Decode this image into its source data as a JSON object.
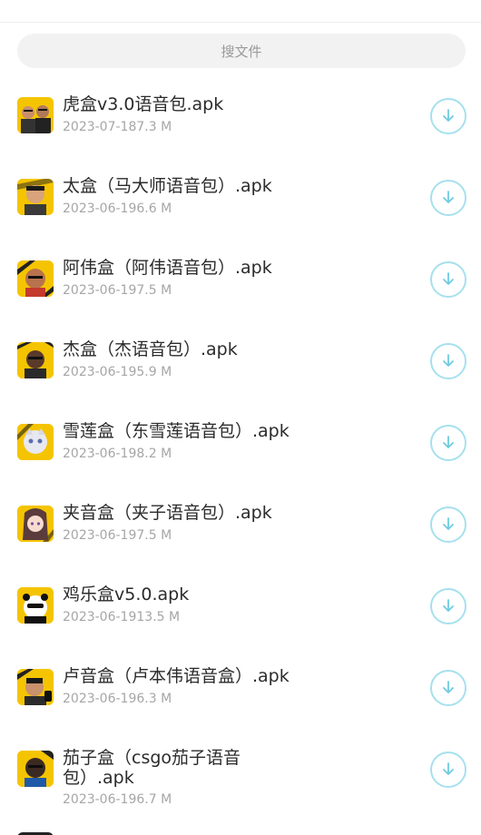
{
  "search": {
    "placeholder": "搜文件"
  },
  "files": [
    {
      "name": "虎盒v3.0语音包.apk",
      "date": "2023-07-18",
      "size": "7.3 M",
      "icon": "avatar-duo-icon"
    },
    {
      "name": "太盒（马大师语音包）.apk",
      "date": "2023-06-19",
      "size": "6.6 M",
      "icon": "avatar-portrait-icon"
    },
    {
      "name": "阿伟盒（阿伟语音包）.apk",
      "date": "2023-06-19",
      "size": "7.5 M",
      "icon": "avatar-portrait-icon"
    },
    {
      "name": "杰盒（杰语音包）.apk",
      "date": "2023-06-19",
      "size": "5.9 M",
      "icon": "avatar-portrait-icon"
    },
    {
      "name": "雪莲盒（东雪莲语音包）.apk",
      "date": "2023-06-19",
      "size": "8.2 M",
      "icon": "avatar-anime-icon"
    },
    {
      "name": "夹音盒（夹子语音包）.apk",
      "date": "2023-06-19",
      "size": "7.5 M",
      "icon": "avatar-anime-icon"
    },
    {
      "name": "鸡乐盒v5.0.apk",
      "date": "2023-06-19",
      "size": "13.5 M",
      "icon": "avatar-panda-icon"
    },
    {
      "name": "卢音盒（卢本伟语音盒）.apk",
      "date": "2023-06-19",
      "size": "6.3 M",
      "icon": "avatar-portrait-icon"
    },
    {
      "name": "茄子盒（csgo茄子语音包）.apk",
      "date": "2023-06-19",
      "size": "6.7 M",
      "icon": "avatar-portrait-icon"
    }
  ],
  "colors": {
    "download_ring": "#a6e0ee",
    "download_arrow": "#6fcbe2",
    "thumb_bg": "#f5c400"
  }
}
